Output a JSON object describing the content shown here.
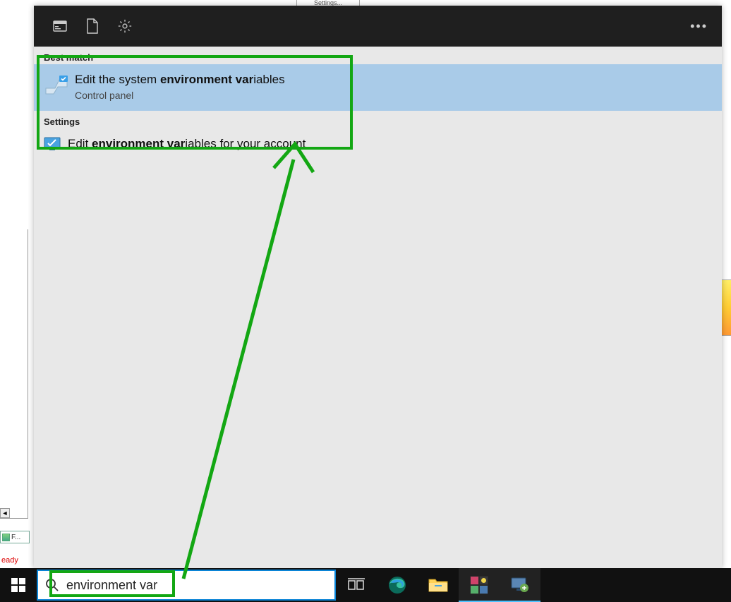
{
  "background": {
    "tab_text": "Settings...",
    "file_tab": "F...",
    "status": "eady"
  },
  "panel": {
    "sections": {
      "best_match": "Best match",
      "settings": "Settings"
    },
    "best_result": {
      "prefix": "Edit the system ",
      "bold": "environment var",
      "suffix": "iables",
      "subtitle": "Control panel"
    },
    "settings_result": {
      "prefix": "Edit ",
      "bold": "environment var",
      "suffix": "iables for your account"
    },
    "header_icons": {
      "apps": "apps-icon",
      "documents": "document-icon",
      "settings": "gear-icon",
      "more": "more-icon"
    }
  },
  "taskbar": {
    "search_value": "environment var",
    "icons": {
      "start": "windows-start",
      "search": "search",
      "taskview": "task-view",
      "edge": "edge",
      "explorer": "file-explorer",
      "app1": "media-app",
      "app2": "remote-desktop"
    }
  }
}
